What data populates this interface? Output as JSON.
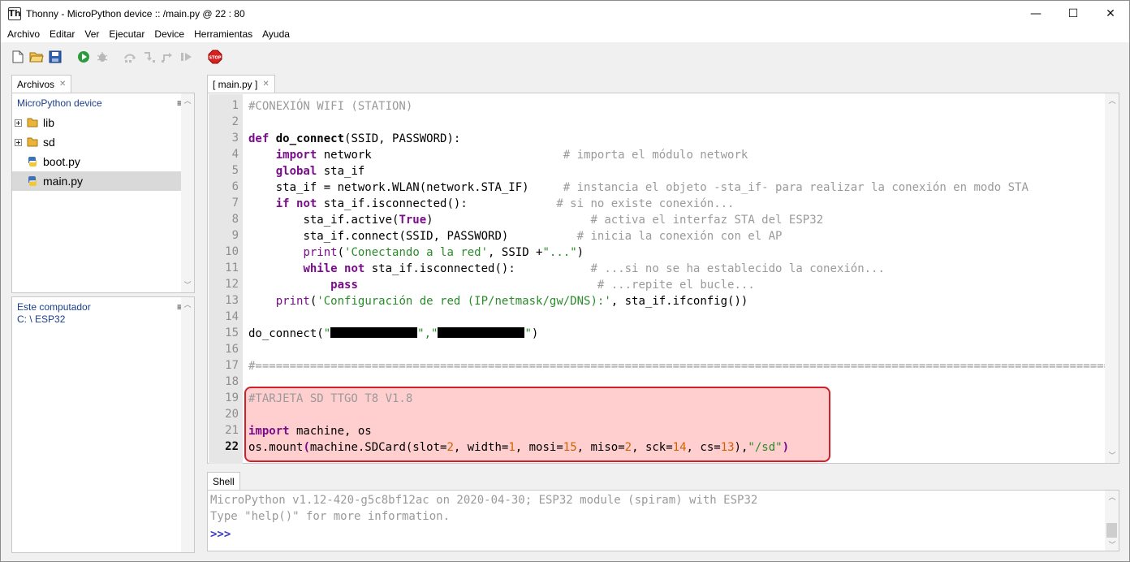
{
  "window": {
    "app_icon": "Th",
    "title": "Thonny  -  MicroPython device :: /main.py  @  22 : 80",
    "minimize": "—",
    "maximize": "☐",
    "close": "✕"
  },
  "menu": [
    "Archivo",
    "Editar",
    "Ver",
    "Ejecutar",
    "Device",
    "Herramientas",
    "Ayuda"
  ],
  "toolbar": {
    "icons": [
      "new-file-icon",
      "open-folder-icon",
      "save-icon",
      "run-icon",
      "debug-icon",
      "step-over-icon",
      "step-into-icon",
      "step-out-icon",
      "resume-icon",
      "stop-icon"
    ],
    "stop_label": "STOP"
  },
  "files_tab": {
    "label": "Archivos",
    "close": "✕"
  },
  "device_pane": {
    "title": "MicroPython device",
    "menu": "≡",
    "items": [
      {
        "name": "lib",
        "type": "folder"
      },
      {
        "name": "sd",
        "type": "folder"
      },
      {
        "name": "boot.py",
        "type": "file"
      },
      {
        "name": "main.py",
        "type": "file",
        "selected": true
      }
    ]
  },
  "computer_pane": {
    "title": "Este computador",
    "menu": "≡",
    "path": "C: \\ ESP32"
  },
  "editor_tab": {
    "label": "[ main.py ]",
    "close": "✕"
  },
  "editor": {
    "line_numbers": [
      "1",
      "2",
      "3",
      "4",
      "5",
      "6",
      "7",
      "8",
      "9",
      "10",
      "11",
      "12",
      "13",
      "14",
      "15",
      "16",
      "17",
      "18",
      "19",
      "20",
      "21",
      "22"
    ],
    "current_line": "22",
    "code": {
      "l1_comment": "#CONEXIÓN WIFI (STATION)",
      "l3_def": "def",
      "l3_fn": "do_connect",
      "l3_rest": "(SSID, PASSWORD):",
      "l4_kw": "import",
      "l4_rest": " network                            ",
      "l4_comment": "# importa el módulo network",
      "l5_kw": "global",
      "l5_rest": " sta_if",
      "l6_code": "sta_if = network.WLAN(network.STA_IF)     ",
      "l6_comment": "# instancia el objeto -sta_if- para realizar la conexión en modo STA",
      "l7_kw1": "if",
      "l7_kw2": "not",
      "l7_rest": " sta_if.isconnected():             ",
      "l7_comment": "# si no existe conexión...",
      "l8_a": "sta_if.active(",
      "l8_b": "True",
      "l8_c": ")                       ",
      "l8_comment": "# activa el interfaz STA del ESP32",
      "l9_code": "sta_if.connect(SSID, PASSWORD)          ",
      "l9_comment": "# inicia la conexión con el AP",
      "l10_fn": "print",
      "l10_a": "(",
      "l10_str1": "'Conectando a la red'",
      "l10_b": ", SSID +",
      "l10_str2": "\"...\"",
      "l10_c": ")",
      "l11_kw1": "while",
      "l11_kw2": "not",
      "l11_rest": " sta_if.isconnected():           ",
      "l11_comment": "# ...si no se ha establecido la conexión...",
      "l12_kw": "pass",
      "l12_pad": "                                   ",
      "l12_comment": "# ...repite el bucle...",
      "l13_fn": "print",
      "l13_a": "(",
      "l13_str": "'Configuración de red (IP/netmask/gw/DNS):'",
      "l13_b": ", sta_if.ifconfig())",
      "l15_a": "do_connect(",
      "l15_q1": "\"",
      "l15_mid": "\",\"",
      "l15_q2": "\"",
      "l15_b": ")",
      "l17_comment": "#=============================================================================================================================",
      "l19_comment": "#TARJETA SD TTGO T8 V1.8",
      "l21_kw": "import",
      "l21_rest": " machine, os",
      "l22_a": "os.mount",
      "l22_p1": "(",
      "l22_b": "machine.SDCard(slot=",
      "l22_n1": "2",
      "l22_c": ", width=",
      "l22_n2": "1",
      "l22_d": ", mosi=",
      "l22_n3": "15",
      "l22_e": ", miso=",
      "l22_n4": "2",
      "l22_f": ", sck=",
      "l22_n5": "14",
      "l22_g": ", cs=",
      "l22_n6": "13",
      "l22_h": "),",
      "l22_str": "\"/sd\"",
      "l22_p2": ")"
    }
  },
  "shell_tab": {
    "label": "Shell"
  },
  "shell": {
    "line1": "MicroPython v1.12-420-g5c8bf12ac on 2020-04-30; ESP32 module (spiram) with ESP32",
    "line2": "Type \"help()\" for more information.",
    "prompt": ">>>"
  },
  "colors": {
    "highlight_bg": "#ffcfcf",
    "highlight_border": "#d0202a",
    "keyword": "#7a0b8b",
    "string": "#2a8c2a",
    "number": "#d06000",
    "comment": "#9a9a9a"
  }
}
